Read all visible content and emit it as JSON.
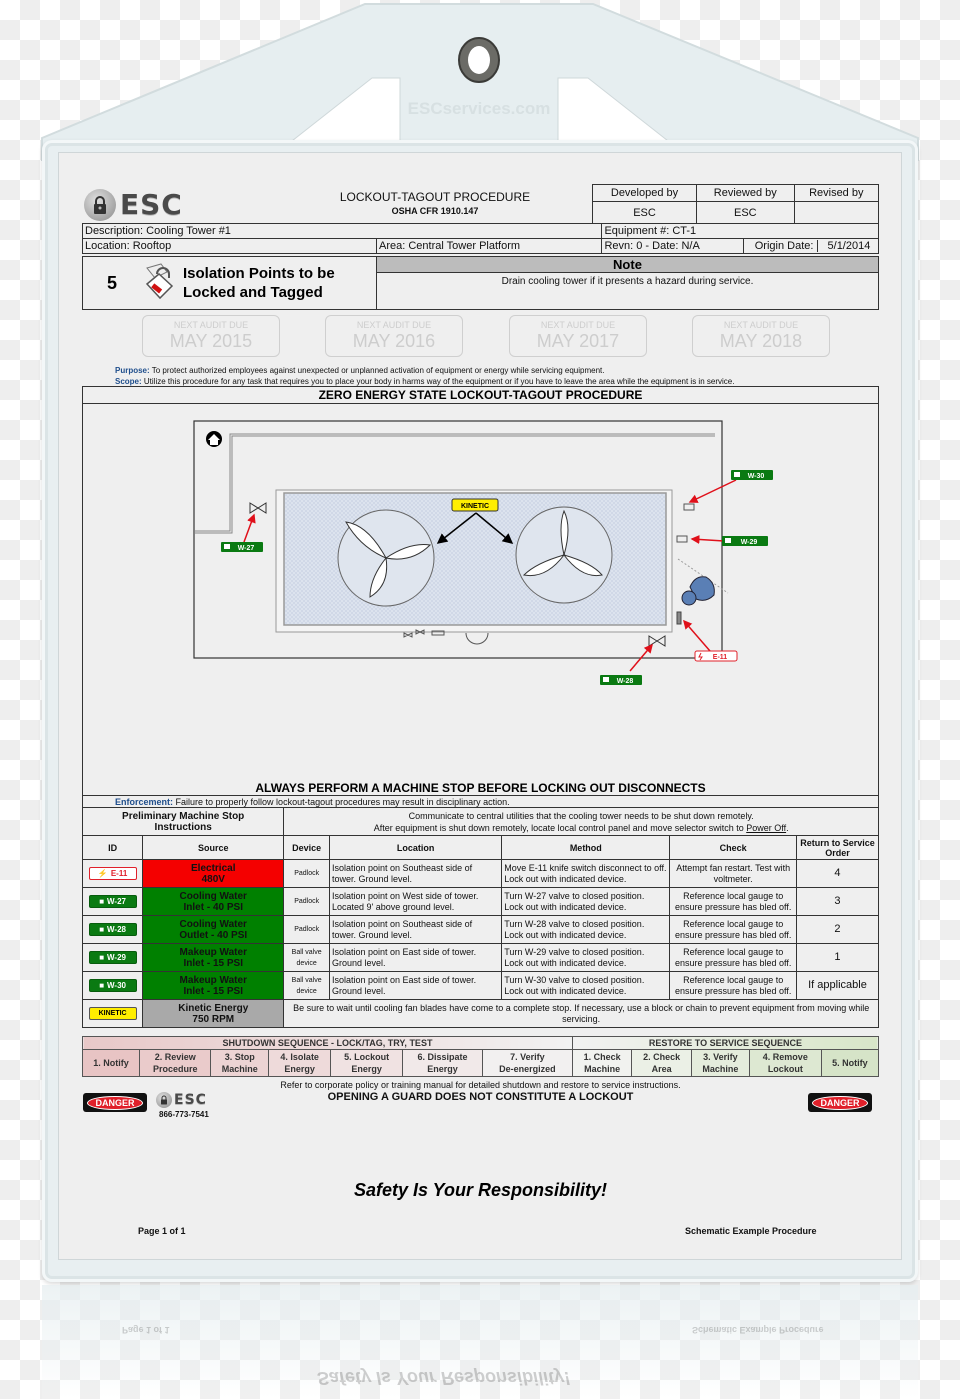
{
  "holder": {
    "brand_watermark": "ESCservices.com"
  },
  "header": {
    "logo_text": "ESC",
    "title": "LOCKOUT-TAGOUT PROCEDURE",
    "subtitle": "OSHA CFR 1910.147",
    "review": {
      "headers": [
        "Developed by",
        "Reviewed by",
        "Revised by"
      ],
      "values": [
        "ESC",
        "ESC",
        ""
      ]
    },
    "description": "Description: Cooling Tower #1",
    "equipment": "Equipment #: CT-1",
    "location": "Location: Rooftop",
    "area": "Area: Central Tower Platform",
    "revision": "Revn: 0  -  Date: N/A",
    "origin_label": "Origin Date:",
    "origin_value": "5/1/2014"
  },
  "isolation": {
    "count": "5",
    "label_line1": "Isolation Points to be",
    "label_line2": "Locked and Tagged",
    "note_title": "Note",
    "note_text": "Drain cooling tower if it presents a hazard during service."
  },
  "audits": [
    {
      "label": "NEXT AUDIT DUE",
      "date": "MAY 2015"
    },
    {
      "label": "NEXT AUDIT DUE",
      "date": "MAY 2016"
    },
    {
      "label": "NEXT AUDIT DUE",
      "date": "MAY 2017"
    },
    {
      "label": "NEXT AUDIT DUE",
      "date": "MAY 2018"
    }
  ],
  "purpose": {
    "label": "Purpose:",
    "text": " To protect authorized employees against unexpected or unplanned activation of equipment or energy while servicing equipment.",
    "scope_label": "Scope:",
    "scope_text": " Utilize this procedure for any task that requires you to place your body in harms way of the equipment or if you have to leave the area while the equipment is in service."
  },
  "diagram": {
    "title": "ZERO ENERGY STATE LOCKOUT-TAGOUT PROCEDURE",
    "labels": {
      "kinetic": "KINETIC",
      "w27": "W-27",
      "w28": "W-28",
      "w29": "W-29",
      "w30": "W-30",
      "e11": "E-11"
    }
  },
  "machine_stop": {
    "banner": "ALWAYS PERFORM A MACHINE STOP BEFORE LOCKING OUT DISCONNECTS",
    "enforcement_label": "Enforcement:",
    "enforcement_text": " Failure to properly follow lockout-tagout procedures may result in disciplinary action.",
    "prelim_label_1": "Preliminary Machine Stop",
    "prelim_label_2": "Instructions",
    "prelim_line1": "Communicate to central utilities that the cooling tower needs to be shut down remotely.",
    "prelim_line2": "After equipment is shut down remotely, locate local control panel and move selector switch to ",
    "prelim_link": "Power Off",
    "prelim_end": "."
  },
  "table": {
    "headers": [
      "ID",
      "Source",
      "Device",
      "Location",
      "Method",
      "Check",
      "Return to Service Order"
    ],
    "rows": [
      {
        "id": "E-11",
        "source1": "Electrical",
        "source2": "480V",
        "device": "Padlock",
        "loc1": "Isolation point on Southeast side of",
        "loc2": "tower.  Ground level.",
        "meth1": "Move E-11 knife switch disconnect to off.",
        "meth2": "Lock out with indicated device.",
        "chk1": "Attempt fan restart. Test with",
        "chk2": "voltmeter.",
        "order": "4"
      },
      {
        "id": "W-27",
        "source1": "Cooling Water",
        "source2": "Inlet - 40 PSI",
        "device": "Padlock",
        "loc1": "Isolation point on West side of tower.",
        "loc2": "Located 9' above ground level.",
        "meth1": "Turn W-27 valve to closed position.",
        "meth2": "Lock out with indicated device.",
        "chk1": "Reference local gauge to",
        "chk2": "ensure pressure has bled off.",
        "order": "3"
      },
      {
        "id": "W-28",
        "source1": "Cooling Water",
        "source2": "Outlet - 40 PSI",
        "device": "Padlock",
        "loc1": "Isolation point on Southeast side of",
        "loc2": "tower.  Ground level.",
        "meth1": "Turn W-28 valve to closed position.",
        "meth2": "Lock out with indicated device.",
        "chk1": "Reference local gauge to",
        "chk2": "ensure pressure has bled off.",
        "order": "2"
      },
      {
        "id": "W-29",
        "source1": "Makeup Water",
        "source2": "Inlet - 15 PSI",
        "device": "Ball valve device",
        "loc1": "Isolation point on East side of tower.",
        "loc2": "Ground level.",
        "meth1": "Turn W-29 valve to closed position.",
        "meth2": "Lock out with indicated device.",
        "chk1": "Reference local gauge to",
        "chk2": "ensure pressure has bled off.",
        "order": "1"
      },
      {
        "id": "W-30",
        "source1": "Makeup Water",
        "source2": "Inlet - 15 PSI",
        "device": "Ball valve device",
        "loc1": "Isolation point on East side of tower.",
        "loc2": "Ground level.",
        "meth1": "Turn W-30 valve to closed position.",
        "meth2": "Lock out with indicated device.",
        "chk1": "Reference local gauge to",
        "chk2": "ensure pressure has bled off.",
        "order": "If applicable"
      }
    ],
    "kinetic": {
      "id": "KINETIC",
      "source1": "Kinetic Energy",
      "source2": "750 RPM",
      "text": "Be sure to wait until cooling fan blades have come to a complete stop.  If necessary, use a block or chain to prevent equipment from moving while servicing."
    }
  },
  "sequence": {
    "shutdown_title": "SHUTDOWN SEQUENCE - LOCK/TAG, TRY, TEST",
    "restore_title": "RESTORE TO SERVICE SEQUENCE",
    "shutdown_steps": [
      [
        "1. Notify",
        ""
      ],
      [
        "2. Review",
        "Procedure"
      ],
      [
        "3. Stop",
        "Machine"
      ],
      [
        "4. Isolate",
        "Energy"
      ],
      [
        "5. Lockout",
        "Energy"
      ],
      [
        "6. Dissipate",
        "Energy"
      ],
      [
        "7. Verify",
        "De-energized"
      ]
    ],
    "restore_steps": [
      [
        "1. Check",
        "Machine"
      ],
      [
        "2. Check",
        "Area"
      ],
      [
        "3. Verify",
        "Machine"
      ],
      [
        "4. Remove",
        "Lockout"
      ],
      [
        "5. Notify",
        ""
      ]
    ]
  },
  "footer": {
    "refer": "Refer to corporate policy or training manual for detailed shutdown and restore to service instructions.",
    "guard": "OPENING A GUARD DOES NOT CONSTITUTE A LOCKOUT",
    "danger": "DANGER",
    "logo_text": "ESC",
    "phone": "866-773-7541",
    "safety": "Safety Is Your Responsibility!",
    "page": "Page 1 of 1",
    "doc_name": "Schematic Example Procedure"
  },
  "colors": {
    "electrical": "#f40000",
    "water": "#008000",
    "kinetic": "#a9a9a9",
    "label_blue": "#1f4e8c",
    "warning_red": "#c00000"
  }
}
